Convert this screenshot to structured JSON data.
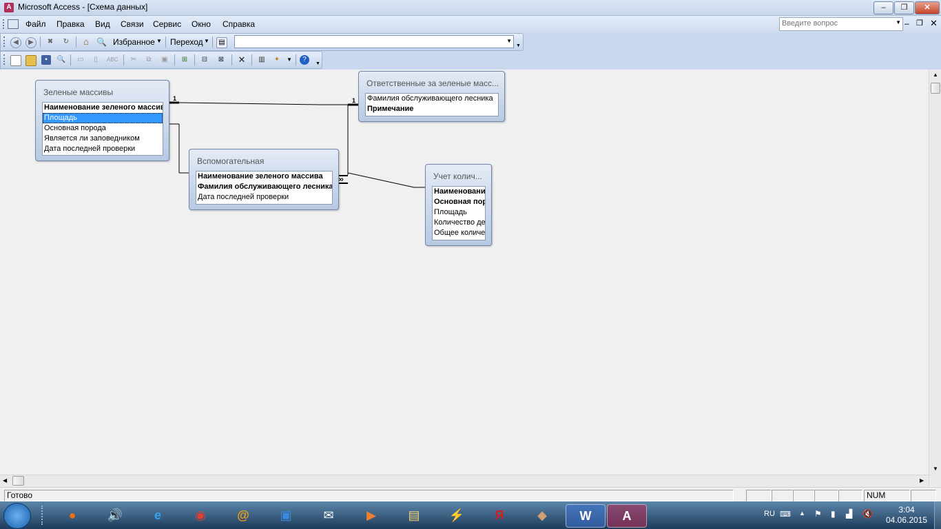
{
  "window": {
    "title": "Microsoft Access - [Схема данных]",
    "app_icon_letter": "A"
  },
  "menu": {
    "items": [
      "Файл",
      "Правка",
      "Вид",
      "Связи",
      "Сервис",
      "Окно",
      "Справка"
    ],
    "help_placeholder": "Введите вопрос"
  },
  "web_toolbar": {
    "favorites_label": "Избранное",
    "go_label": "Переход"
  },
  "tables": [
    {
      "title": "Зеленые массивы",
      "fields": [
        {
          "name": "Наименование зеленого массива",
          "key": true
        },
        {
          "name": "Площадь",
          "key": false,
          "selected": true
        },
        {
          "name": "Основная порода",
          "key": false
        },
        {
          "name": "Является ли заповедником",
          "key": false
        },
        {
          "name": "Дата последней проверки",
          "key": false
        }
      ]
    },
    {
      "title": "Ответственные за зеленые масс...",
      "fields": [
        {
          "name": "Фамилия обслуживающего лесника",
          "key": false
        },
        {
          "name": "Примечание",
          "key": true
        }
      ]
    },
    {
      "title": "Вспомогательная",
      "fields": [
        {
          "name": "Наименование зеленого массива",
          "key": true
        },
        {
          "name": "Фамилия обслуживающего лесника",
          "key": true
        },
        {
          "name": "Дата последней проверки",
          "key": false
        }
      ]
    },
    {
      "title": "Учет колич...",
      "fields": [
        {
          "name": "Наименование",
          "key": true
        },
        {
          "name": "Основная поро",
          "key": true
        },
        {
          "name": "Площадь",
          "key": false
        },
        {
          "name": "Количество де",
          "key": false
        },
        {
          "name": "Общее количе",
          "key": false
        }
      ]
    }
  ],
  "relationships": {
    "one_label": "1",
    "many_label": "∞"
  },
  "status": {
    "text": "Готово",
    "num": "NUM"
  },
  "tray": {
    "lang": "RU",
    "time": "3:04",
    "date": "04.06.2015"
  },
  "taskbar_apps": [
    "firefox-icon",
    "volume-icon",
    "ie-icon",
    "chrome-icon",
    "mailru-icon",
    "maxthon-icon",
    "mail-icon",
    "media-player-icon",
    "explorer-icon",
    "winamp-icon",
    "yandex-icon",
    "mahjong-icon",
    "word-icon",
    "access-icon"
  ],
  "colors": {
    "selection": "#3399ff",
    "title_gradient_top": "#dbe6f4",
    "table_header": "#b8c9e2"
  }
}
